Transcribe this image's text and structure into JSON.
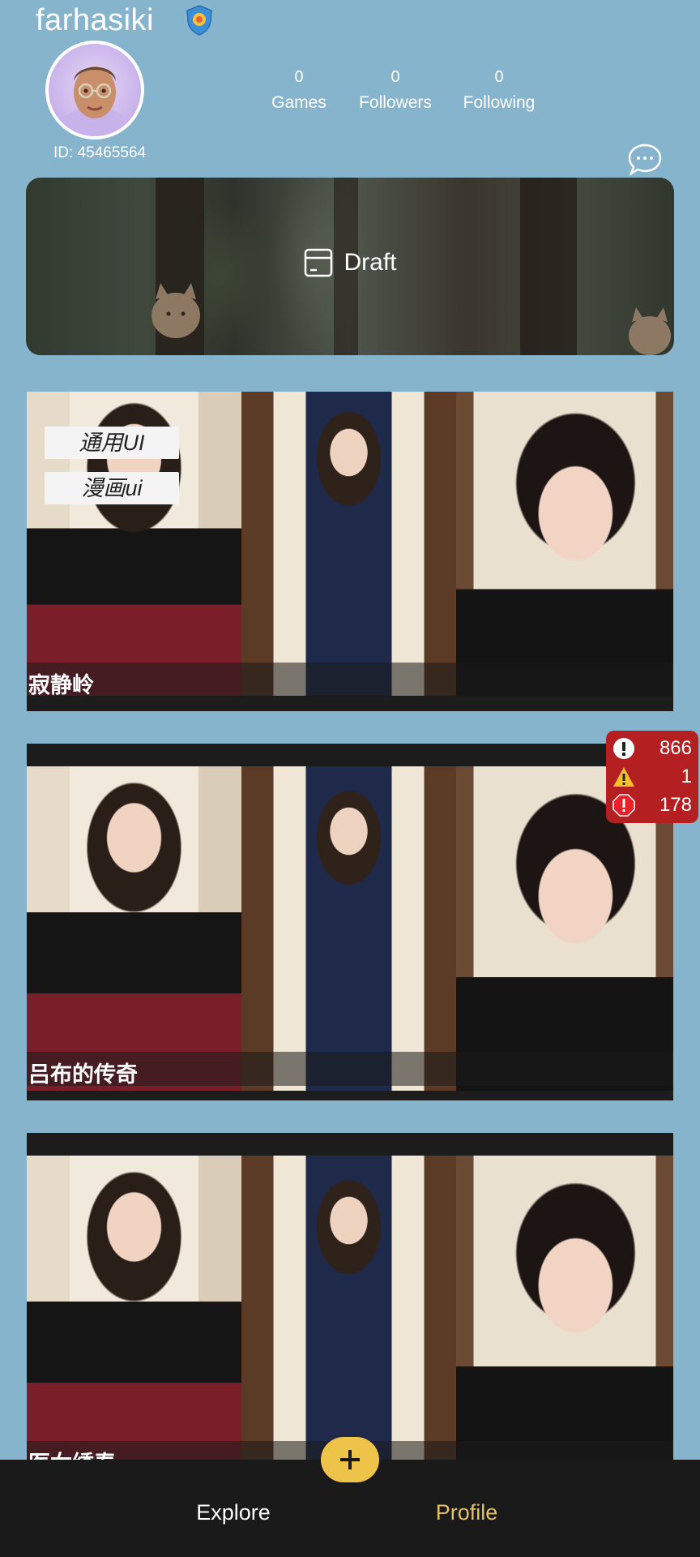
{
  "profile": {
    "username": "farhasiki",
    "user_id": "ID: 45465564",
    "stats": [
      {
        "value": "0",
        "label": "Games"
      },
      {
        "value": "0",
        "label": "Followers"
      },
      {
        "value": "0",
        "label": "Following"
      }
    ]
  },
  "draft": {
    "label": "Draft"
  },
  "games": [
    {
      "title": "寂静岭",
      "tags": [
        "通用UI",
        "漫画ui"
      ]
    },
    {
      "title": "吕布的传奇",
      "tags": []
    },
    {
      "title": "医女绣春",
      "tags": []
    }
  ],
  "counters": [
    {
      "icon": "info-circle-icon",
      "value": "866"
    },
    {
      "icon": "warning-triangle-icon",
      "value": "1"
    },
    {
      "icon": "error-octagon-icon",
      "value": "178"
    }
  ],
  "nav": {
    "explore": "Explore",
    "profile": "Profile"
  },
  "colors": {
    "background": "#86b4cd",
    "accent": "#eec34a",
    "counter_panel": "#b41f22",
    "nav_active": "#e3c06a"
  }
}
